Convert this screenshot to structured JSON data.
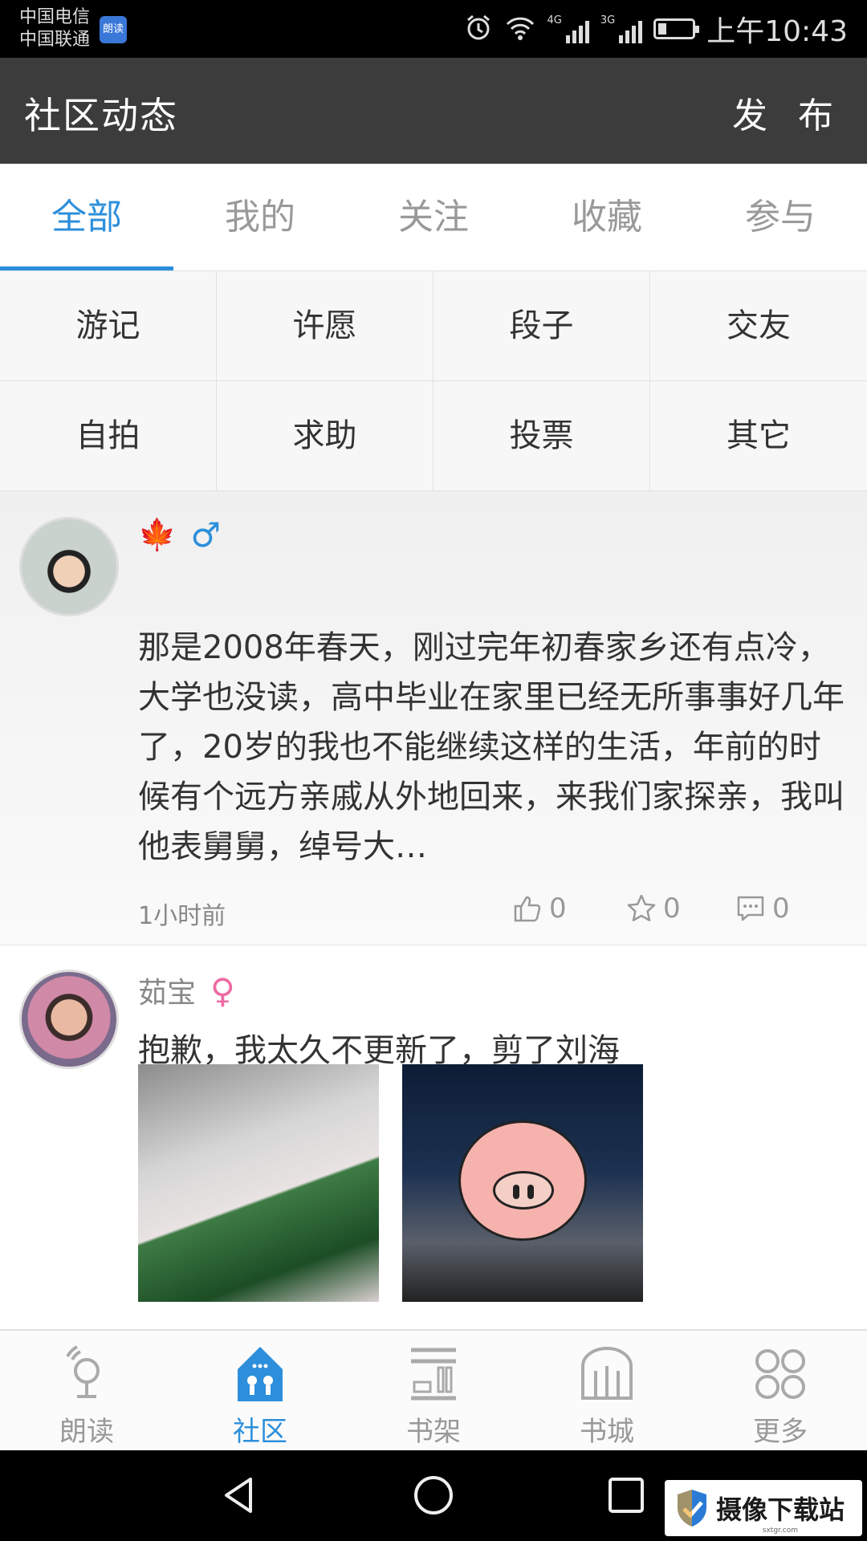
{
  "status_bar": {
    "carrier_1": "中国电信",
    "carrier_2": "中国联通",
    "app_badge": "朗读",
    "net_4g": "4G",
    "net_3g": "3G",
    "time": "上午10:43"
  },
  "header": {
    "title": "社区动态",
    "publish_label": "发 布"
  },
  "tabs": [
    {
      "label": "全部",
      "active": true
    },
    {
      "label": "我的"
    },
    {
      "label": "关注"
    },
    {
      "label": "收藏"
    },
    {
      "label": "参与"
    }
  ],
  "categories": [
    "游记",
    "许愿",
    "段子",
    "交友",
    "自拍",
    "求助",
    "投票",
    "其它"
  ],
  "posts": [
    {
      "username": "",
      "badge_icon": "maple-leaf-icon",
      "gender": "male",
      "gender_symbol": "♂",
      "text": "那是2008年春天，刚过完年初春家乡还有点冷，大学也没读，高中毕业在家里已经无所事事好几年了，20岁的我也不能继续这样的生活，年前的时候有个远方亲戚从外地回来，来我们家探亲，我叫他表舅舅，绰号大…",
      "time": "1小时前",
      "likes": "0",
      "favorites": "0",
      "comments": "0"
    },
    {
      "username": "茹宝",
      "gender": "female",
      "gender_symbol": "♀",
      "text": "抱歉，我太久不更新了，剪了刘海",
      "photo_count": 2
    }
  ],
  "bottom_nav": [
    {
      "label": "朗读",
      "icon": "microphone-icon"
    },
    {
      "label": "社区",
      "icon": "community-house-icon",
      "active": true
    },
    {
      "label": "书架",
      "icon": "bookshelf-icon"
    },
    {
      "label": "书城",
      "icon": "bookstore-icon"
    },
    {
      "label": "更多",
      "icon": "more-grid-icon"
    }
  ],
  "watermark": {
    "text": "摄像下载站",
    "url": "sxtgr.com"
  },
  "colors": {
    "accent": "#2d8fdb",
    "header_bg": "#3c3c3c",
    "status_bg": "#000000"
  }
}
